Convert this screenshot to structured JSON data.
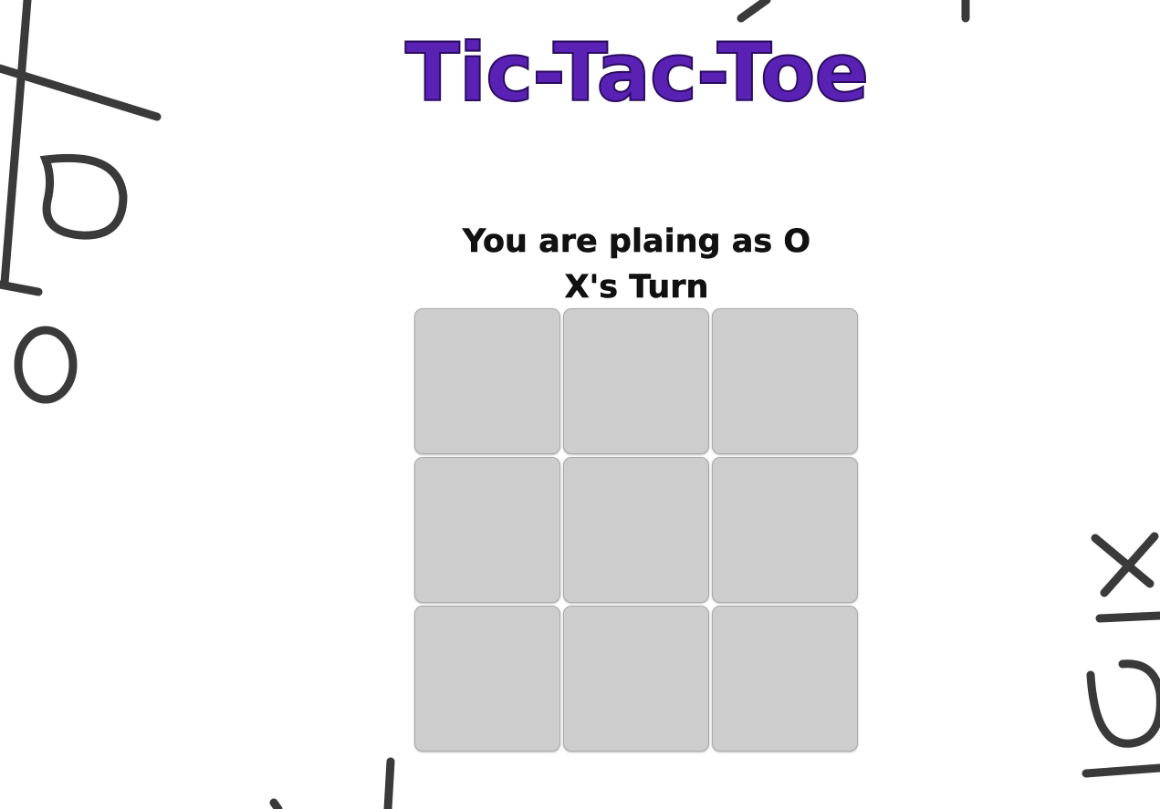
{
  "title": "Tic-Tac-Toe",
  "status": {
    "player_info": "You are plaing as O",
    "turn_info": "X's Turn"
  },
  "board": {
    "cells": [
      "",
      "",
      "",
      "",
      "",
      "",
      "",
      "",
      ""
    ]
  },
  "colors": {
    "title": "#5a22b4",
    "title_outline": "#2a0b5e",
    "cell_bg": "#cdcdcd",
    "text": "#111111"
  }
}
